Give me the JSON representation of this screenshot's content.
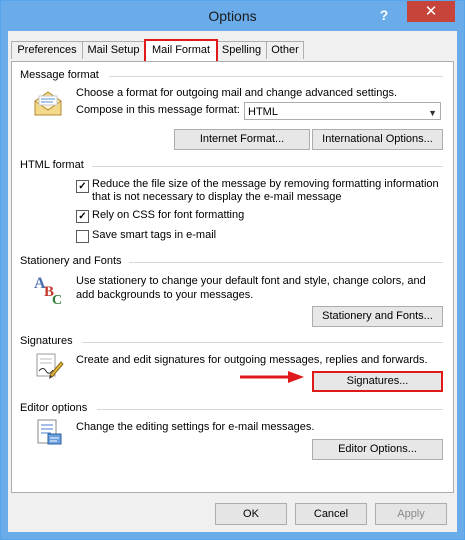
{
  "window": {
    "title": "Options",
    "help": "?",
    "close": "✕"
  },
  "tabs": [
    {
      "label": "Preferences"
    },
    {
      "label": "Mail Setup"
    },
    {
      "label": "Mail Format"
    },
    {
      "label": "Spelling"
    },
    {
      "label": "Other"
    }
  ],
  "message_format": {
    "title": "Message format",
    "description": "Choose a format for outgoing mail and change advanced settings.",
    "compose_label": "Compose in this message format:",
    "compose_value": "HTML",
    "internet_button": "Internet Format...",
    "international_button": "International Options..."
  },
  "html_format": {
    "title": "HTML format",
    "options": [
      {
        "label": "Reduce the file size of the message by removing formatting information",
        "label2": "that is not necessary to display the e-mail message",
        "checked": true
      },
      {
        "label": "Rely on CSS for font formatting",
        "checked": true
      },
      {
        "label": "Save smart tags in e-mail",
        "checked": false
      }
    ],
    "check_mark": "✓"
  },
  "stationery": {
    "title": "Stationery and Fonts",
    "line1": "Use stationery to change your default font and style, change colors, and",
    "line2": "add backgrounds to your messages.",
    "button": "Stationery and Fonts..."
  },
  "signatures": {
    "title": "Signatures",
    "description": "Create and edit signatures for outgoing messages, replies and forwards.",
    "button": "Signatures..."
  },
  "editor": {
    "title": "Editor options",
    "description": "Change the editing settings for e-mail messages.",
    "button": "Editor Options..."
  },
  "footer": {
    "ok": "OK",
    "cancel": "Cancel",
    "apply": "Apply"
  },
  "colors": {
    "highlight": "#e0191b",
    "titlebar": "#6aabea"
  }
}
